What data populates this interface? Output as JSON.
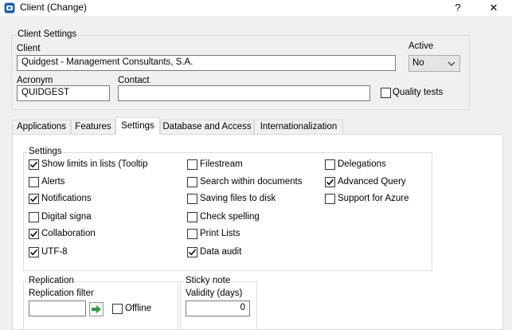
{
  "window": {
    "title": "Client (Change)",
    "help_glyph": "?",
    "close_glyph": "✕",
    "app_icon": "app-icon",
    "accent": "#1a5fb4"
  },
  "client_settings": {
    "legend": "Client Settings",
    "client_label": "Client",
    "client_value": "Quidgest - Management Consultants, S.A.",
    "active_label": "Active",
    "active_value": "No",
    "acronym_label": "Acronym",
    "acronym_value": "QUIDGEST",
    "contact_label": "Contact",
    "contact_value": "",
    "quality_tests_label": "Quality tests",
    "quality_tests_checked": false
  },
  "tabs": [
    {
      "label": "Applications",
      "active": false
    },
    {
      "label": "Features",
      "active": false
    },
    {
      "label": "Settings",
      "active": true
    },
    {
      "label": "Database and Access",
      "active": false
    },
    {
      "label": "Internationalization",
      "active": false
    }
  ],
  "settings": {
    "legend": "Settings",
    "col1": [
      {
        "label": "Show limits in lists (Tooltip",
        "checked": true
      },
      {
        "label": "Alerts",
        "checked": false
      },
      {
        "label": "Notifications",
        "checked": true
      },
      {
        "label": "Digital signa",
        "checked": false
      },
      {
        "label": "Collaboration",
        "checked": true
      },
      {
        "label": "UTF-8",
        "checked": true
      }
    ],
    "col2": [
      {
        "label": "Filestream",
        "checked": false
      },
      {
        "label": "Search within documents",
        "checked": false
      },
      {
        "label": "Saving files to disk",
        "checked": false
      },
      {
        "label": "Check spelling",
        "checked": false
      },
      {
        "label": "Print Lists",
        "checked": false
      },
      {
        "label": "Data audit",
        "checked": true
      }
    ],
    "col3": [
      {
        "label": "Delegations",
        "checked": false
      },
      {
        "label": "Advanced Query",
        "checked": true
      },
      {
        "label": "Support for Azure",
        "checked": false
      }
    ]
  },
  "replication": {
    "legend": "Replication",
    "filter_label": "Replication filter",
    "filter_value": "",
    "offline_label": "Offline",
    "offline_checked": false
  },
  "sticky_note": {
    "legend": "Sticky note",
    "validity_label": "Validity (days)",
    "validity_value": "0"
  }
}
